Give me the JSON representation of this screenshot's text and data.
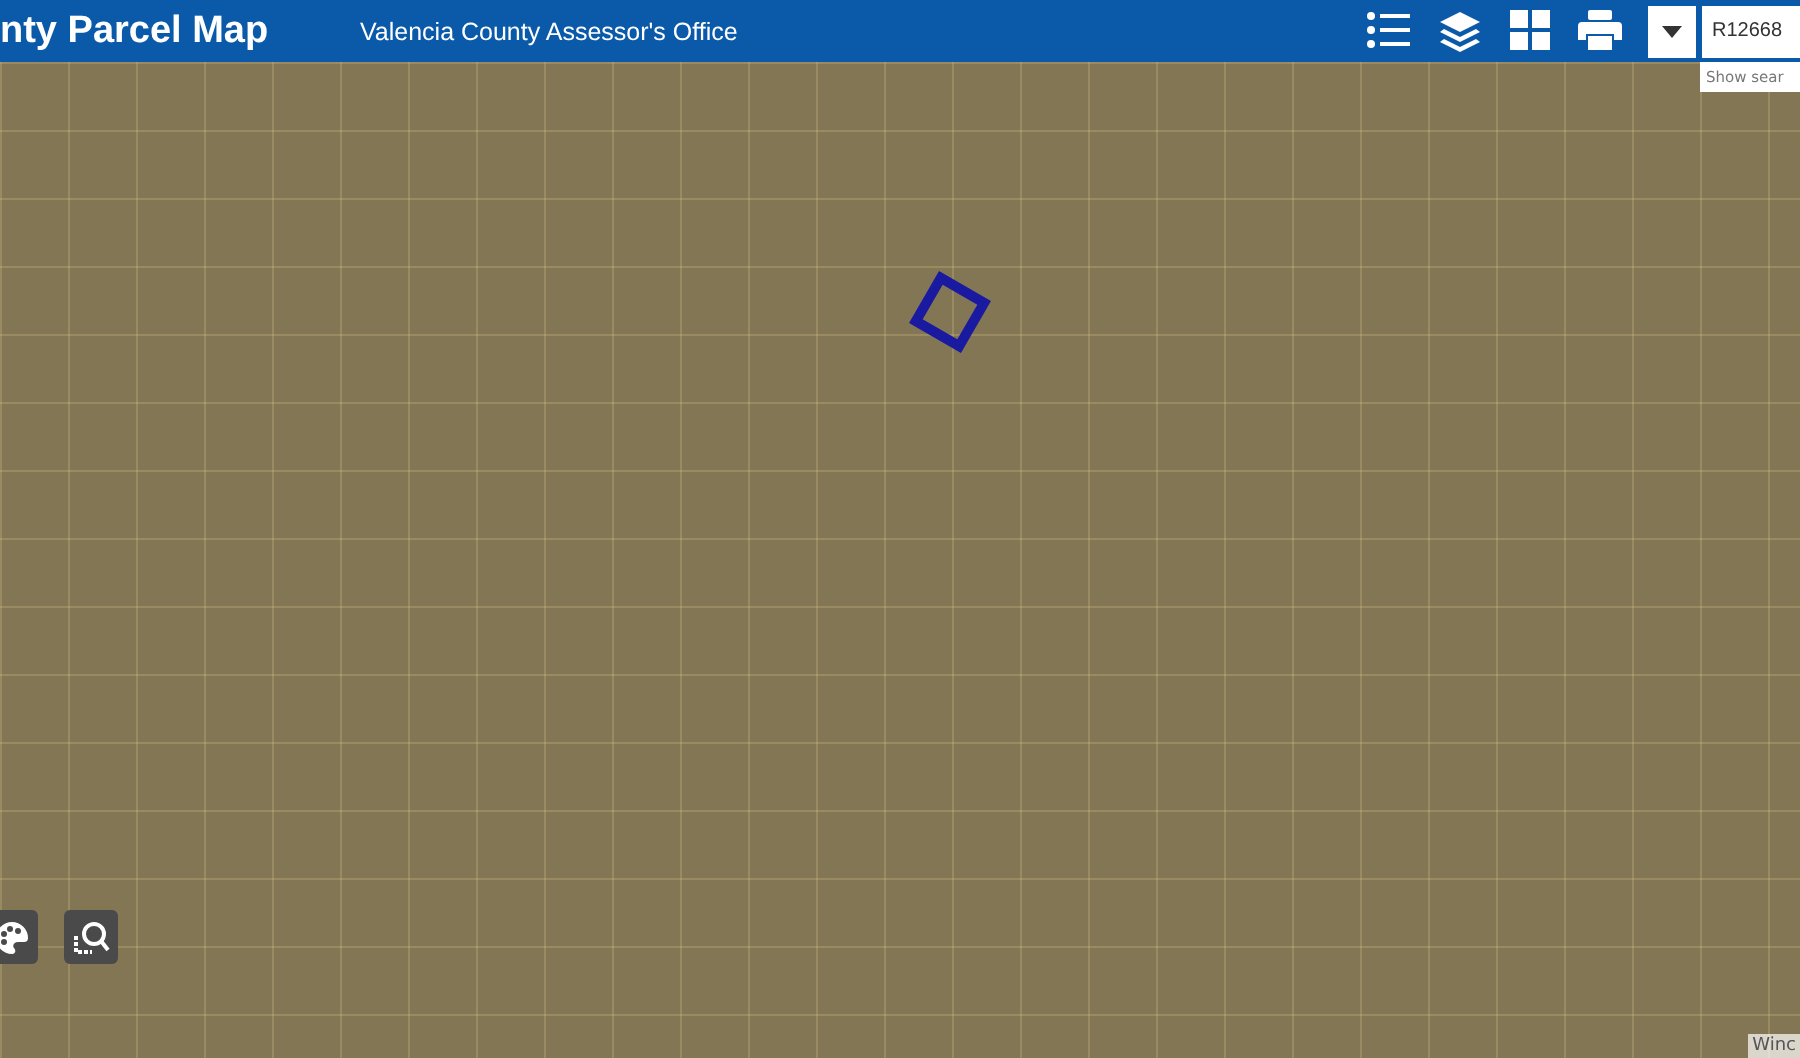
{
  "header": {
    "title": "nty Parcel Map",
    "subtitle": "Valencia County Assessor's Office",
    "tools": [
      {
        "kind": "list"
      },
      {
        "kind": "layers"
      },
      {
        "kind": "grid"
      },
      {
        "kind": "print"
      }
    ]
  },
  "search": {
    "value": "R12668",
    "placeholder": "Show sear"
  },
  "map": {
    "tools": [
      {
        "kind": "palette"
      },
      {
        "kind": "zoom"
      }
    ],
    "attribution": "Winc"
  }
}
